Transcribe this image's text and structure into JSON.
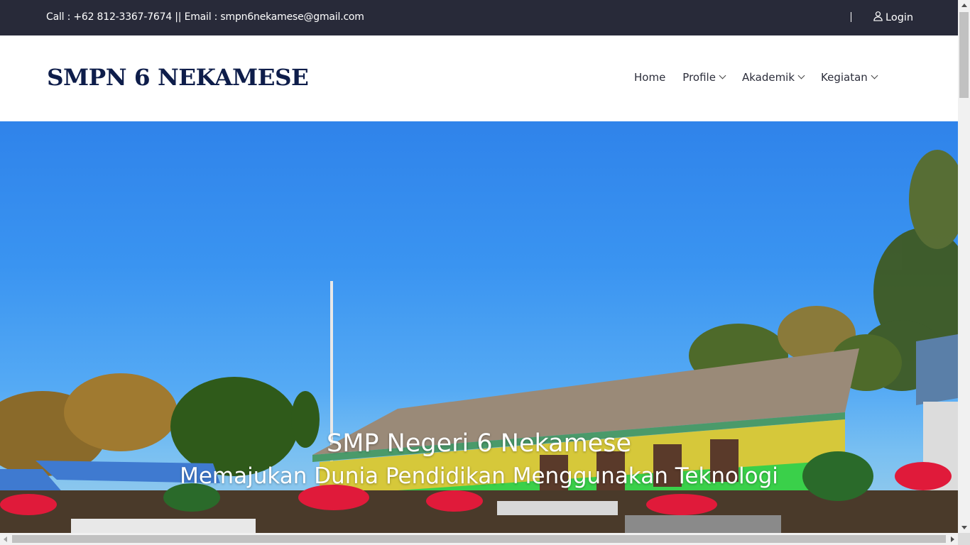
{
  "topbar": {
    "contact_text": "Call : +62 812-3367-7674 || Email : smpn6nekamese@gmail.com",
    "login_label": "Login",
    "login_icon": "user-icon"
  },
  "header": {
    "logo_text": "SMPN 6 NEKAMESE",
    "nav": [
      {
        "label": "Home",
        "has_dropdown": false
      },
      {
        "label": "Profile",
        "has_dropdown": true
      },
      {
        "label": "Akademik",
        "has_dropdown": true
      },
      {
        "label": "Kegiatan",
        "has_dropdown": true
      }
    ]
  },
  "hero": {
    "title": "SMP Negeri 6 Nekamese",
    "subtitle": "Memajukan Dunia Pendidikan Menggunakan Teknologi"
  },
  "colors": {
    "topbar_bg": "#282a39",
    "logo": "#0e1d4a",
    "sky": "#3a94f1"
  }
}
